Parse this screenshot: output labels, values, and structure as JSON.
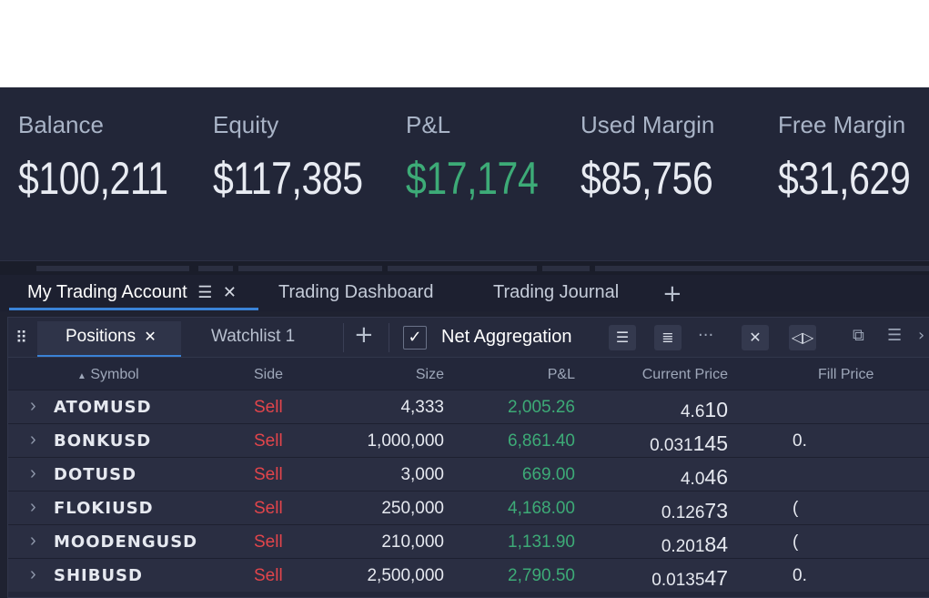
{
  "summary": {
    "balance": {
      "label": "Balance",
      "value": "$100,211"
    },
    "equity": {
      "label": "Equity",
      "value": "$117,385"
    },
    "pnl": {
      "label": "P&L",
      "value": "$17,174"
    },
    "used_margin": {
      "label": "Used Margin",
      "value": "$85,756"
    },
    "free_margin": {
      "label": "Free Margin",
      "value": "$31,629"
    }
  },
  "workspace_tabs": [
    {
      "label": "My Trading Account",
      "active": true
    },
    {
      "label": "Trading Dashboard",
      "active": false
    },
    {
      "label": "Trading Journal",
      "active": false
    }
  ],
  "panel": {
    "tabs": [
      {
        "label": "Positions",
        "active": true
      },
      {
        "label": "Watchlist 1",
        "active": false
      }
    ],
    "net_aggregation": {
      "label": "Net Aggregation",
      "checked": true
    }
  },
  "table": {
    "columns": {
      "symbol": "Symbol",
      "side": "Side",
      "size": "Size",
      "pnl": "P&L",
      "current_price": "Current Price",
      "fill_price": "Fill Price"
    },
    "rows": [
      {
        "symbol": "ATOMUSD",
        "side": "Sell",
        "size": "4,333",
        "pnl": "2,005.26",
        "price_main": "4.6",
        "price_big": "10",
        "fill": ""
      },
      {
        "symbol": "BONKUSD",
        "side": "Sell",
        "size": "1,000,000",
        "pnl": "6,861.40",
        "price_main": "0.031",
        "price_big": "145",
        "fill": "0."
      },
      {
        "symbol": "DOTUSD",
        "side": "Sell",
        "size": "3,000",
        "pnl": "669.00",
        "price_main": "4.0",
        "price_big": "46",
        "fill": ""
      },
      {
        "symbol": "FLOKIUSD",
        "side": "Sell",
        "size": "250,000",
        "pnl": "4,168.00",
        "price_main": "0.126",
        "price_big": "73",
        "fill": "("
      },
      {
        "symbol": "MOODENGUSD",
        "side": "Sell",
        "size": "210,000",
        "pnl": "1,131.90",
        "price_main": "0.201",
        "price_big": "84",
        "fill": "("
      },
      {
        "symbol": "SHIBUSD",
        "side": "Sell",
        "size": "2,500,000",
        "pnl": "2,790.50",
        "price_main": "0.0135",
        "price_big": "47",
        "fill": "0."
      }
    ]
  },
  "colors": {
    "positive": "#3dab77",
    "sell": "#e2454b",
    "accent": "#3a82d6"
  }
}
